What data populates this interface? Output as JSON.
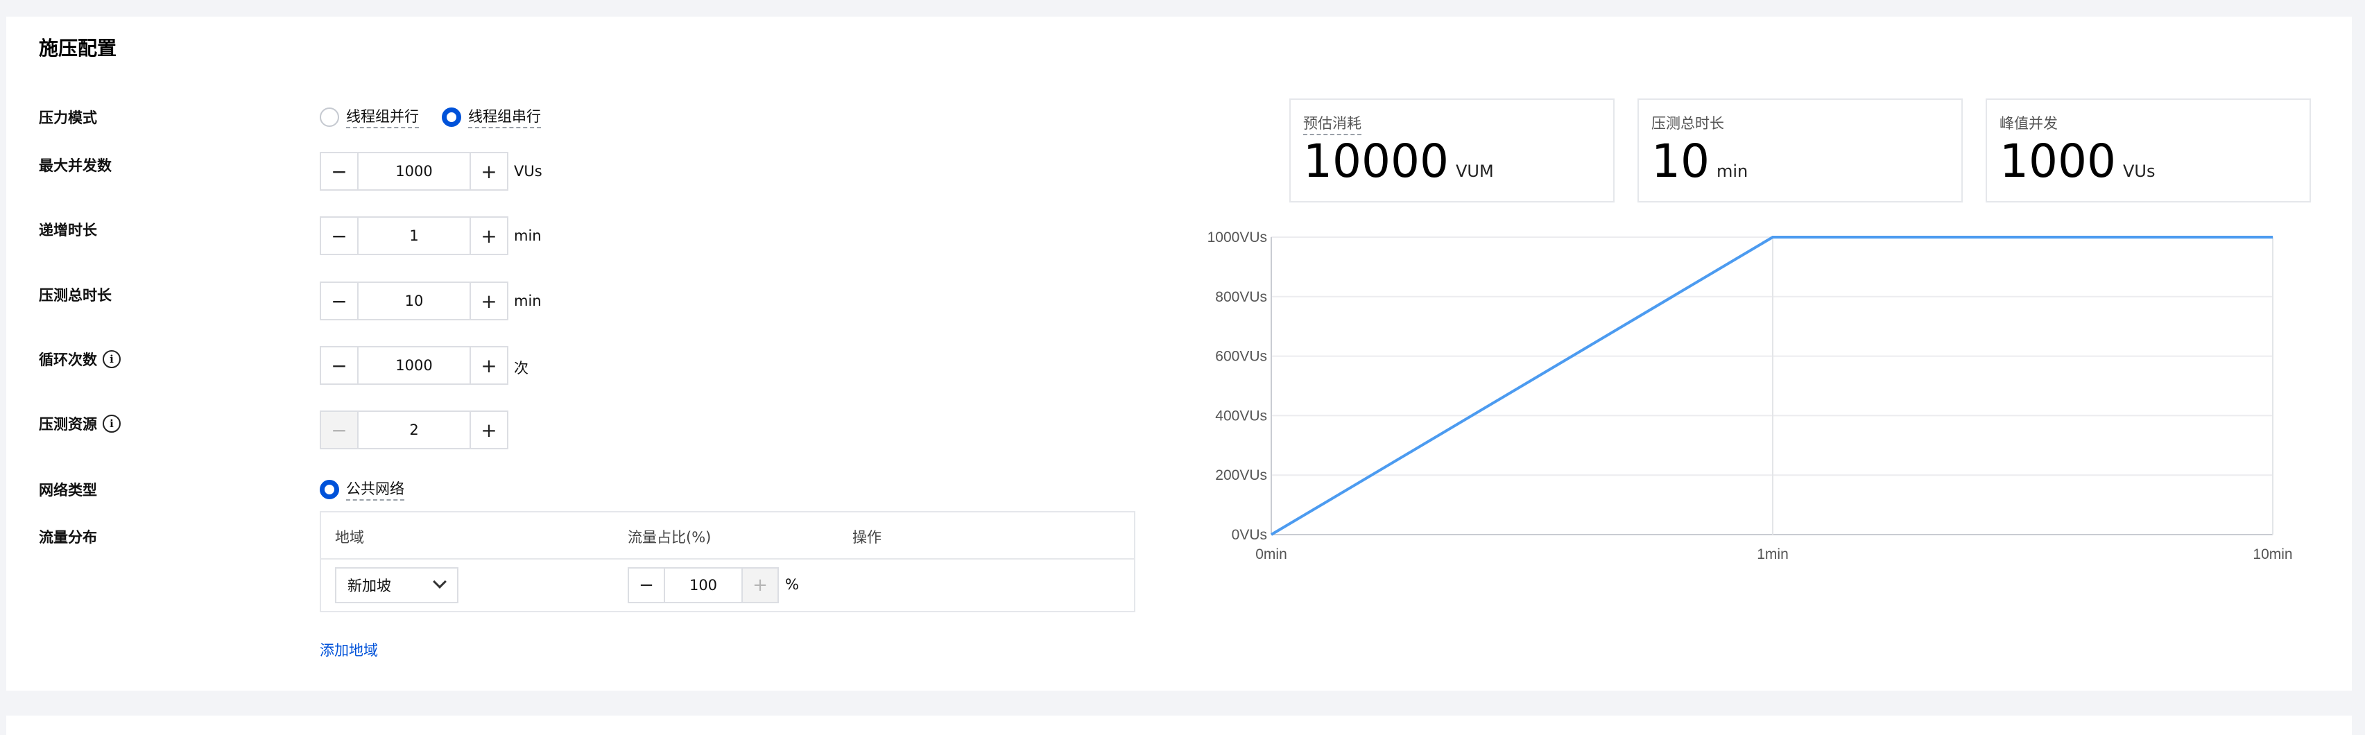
{
  "page_title": "施压配置",
  "pressure_mode": {
    "label": "压力模式",
    "options": [
      "线程组并行",
      "线程组串行"
    ],
    "selected": "线程组串行"
  },
  "max_concurrency": {
    "label": "最大并发数",
    "value": "1000",
    "unit": "VUs",
    "minus_icon": "minus-icon",
    "plus_icon": "plus-icon"
  },
  "ramp_duration": {
    "label": "递增时长",
    "value": "1",
    "unit": "min"
  },
  "total_duration": {
    "label": "压测总时长",
    "value": "10",
    "unit": "min"
  },
  "loop_count": {
    "label": "循环次数",
    "value": "1000",
    "unit": "次",
    "info_icon": "info-icon"
  },
  "resources": {
    "label": "压测资源",
    "value": "2",
    "info_icon": "info-icon"
  },
  "network_type": {
    "label": "网络类型",
    "option": "公共网络",
    "selected": true
  },
  "traffic": {
    "label": "流量分布",
    "columns": [
      "地域",
      "流量占比(%)",
      "操作"
    ],
    "rows": [
      {
        "region": "新加坡",
        "percent": "100",
        "unit": "%"
      }
    ],
    "add_link": "添加地域"
  },
  "stats": [
    {
      "label": "预估消耗",
      "value": "10000",
      "unit": "VUM"
    },
    {
      "label": "压测总时长",
      "value": "10",
      "unit": "min"
    },
    {
      "label": "峰值并发",
      "value": "1000",
      "unit": "VUs"
    }
  ],
  "colors": {
    "accent": "#0052d9",
    "line": "#4c9bf0"
  },
  "chart_data": {
    "type": "line",
    "x_labels": [
      "0min",
      "1min",
      "10min"
    ],
    "y_ticks": [
      "0VUs",
      "200VUs",
      "400VUs",
      "600VUs",
      "800VUs",
      "1000VUs"
    ],
    "series": [
      {
        "points": [
          {
            "x": 0,
            "y": 0
          },
          {
            "x": 1,
            "y": 1000
          },
          {
            "x": 10,
            "y": 1000
          }
        ]
      }
    ],
    "ylim": [
      0,
      1000
    ],
    "grid": true
  }
}
